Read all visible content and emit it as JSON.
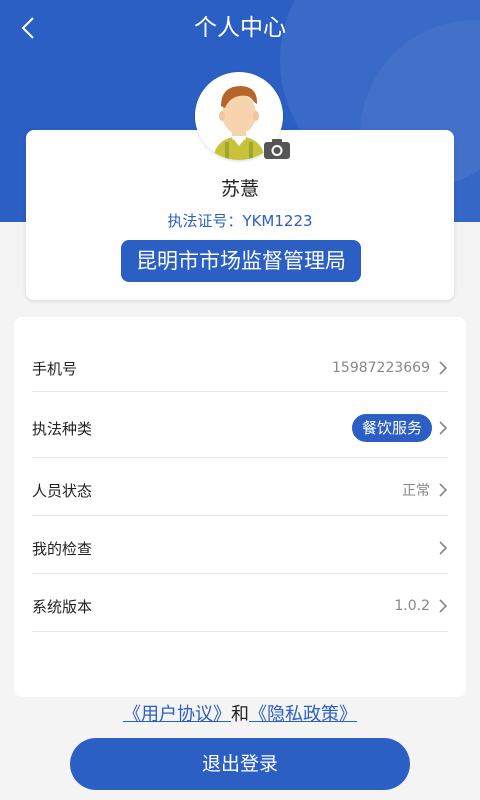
{
  "header": {
    "title": "个人中心"
  },
  "profile": {
    "name": "苏薏",
    "cert_label": "执法证号：YKM1223",
    "agency": "昆明市市场监督管理局"
  },
  "info": {
    "rows": [
      {
        "label": "手机号",
        "value": "15987223669"
      },
      {
        "label": "执法种类",
        "value": "餐饮服务"
      },
      {
        "label": "人员状态",
        "value": "正常"
      },
      {
        "label": "我的检查",
        "value": ""
      },
      {
        "label": "系统版本",
        "value": "1.0.2"
      }
    ]
  },
  "footer": {
    "user_agreement": "《用户协议》",
    "conjunction": "和",
    "privacy_policy": "《隐私政策》",
    "logout": "退出登录"
  },
  "colors": {
    "primary": "#2b5fc4",
    "background": "#f4f4f4"
  }
}
